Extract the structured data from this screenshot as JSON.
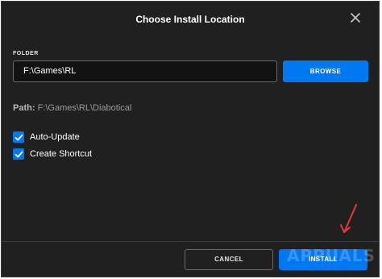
{
  "dialog": {
    "title": "Choose Install Location",
    "close_icon": "close-icon"
  },
  "folder": {
    "section_label": "FOLDER",
    "value": "F:\\Games\\RL",
    "browse_label": "BROWSE"
  },
  "path": {
    "label": "Path:",
    "value": "F:\\Games\\RL\\Diabotical"
  },
  "options": [
    {
      "label": "Auto-Update",
      "checked": true
    },
    {
      "label": "Create Shortcut",
      "checked": true
    }
  ],
  "footer": {
    "cancel_label": "CANCEL",
    "install_label": "INSTALL"
  },
  "annotation": {
    "arrow_color": "#e53935"
  },
  "watermark": {
    "text": "APPUALS"
  },
  "colors": {
    "accent": "#0078f2",
    "background": "#202020"
  }
}
